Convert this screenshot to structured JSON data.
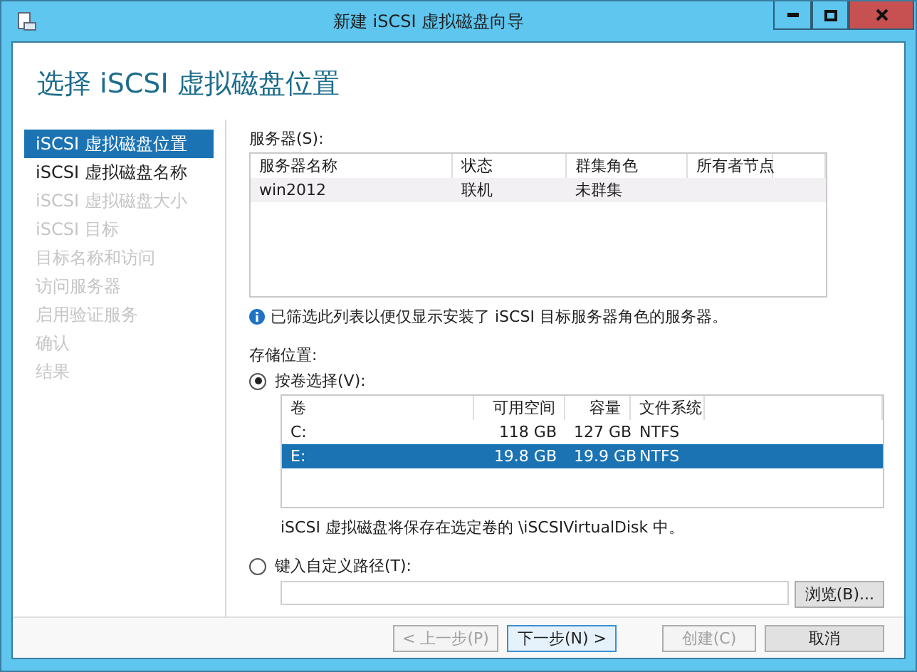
{
  "window": {
    "title": "新建 iSCSI 虚拟磁盘向导"
  },
  "heading": "选择 iSCSI 虚拟磁盘位置",
  "steps": [
    {
      "label": "iSCSI 虚拟磁盘位置",
      "selected": true,
      "disabled": false
    },
    {
      "label": "iSCSI 虚拟磁盘名称",
      "selected": false,
      "disabled": false
    },
    {
      "label": "iSCSI 虚拟磁盘大小",
      "selected": false,
      "disabled": true
    },
    {
      "label": "iSCSI 目标",
      "selected": false,
      "disabled": true
    },
    {
      "label": "目标名称和访问",
      "selected": false,
      "disabled": true
    },
    {
      "label": "访问服务器",
      "selected": false,
      "disabled": true
    },
    {
      "label": "启用验证服务",
      "selected": false,
      "disabled": true
    },
    {
      "label": "确认",
      "selected": false,
      "disabled": true
    },
    {
      "label": "结果",
      "selected": false,
      "disabled": true
    }
  ],
  "servers": {
    "label": "服务器(S):",
    "columns": [
      "服务器名称",
      "状态",
      "群集角色",
      "所有者节点"
    ],
    "rows": [
      {
        "cells": [
          "win2012",
          "联机",
          "未群集",
          ""
        ],
        "selected": false
      }
    ]
  },
  "info_note": "已筛选此列表以便仅显示安装了 iSCSI 目标服务器角色的服务器。",
  "storage_label": "存储位置:",
  "by_volume": {
    "label": "按卷选择(V):",
    "selected": true
  },
  "volumes": {
    "columns": [
      "卷",
      "可用空间",
      "容量",
      "文件系统"
    ],
    "rows": [
      {
        "cells": [
          "C:",
          "118 GB",
          "127 GB",
          "NTFS"
        ],
        "selected": false
      },
      {
        "cells": [
          "E:",
          "19.8 GB",
          "19.9 GB",
          "NTFS"
        ],
        "selected": true
      }
    ]
  },
  "volume_note": "iSCSI 虚拟磁盘将保存在选定卷的 \\iSCSIVirtualDisk 中。",
  "custom_path": {
    "label": "键入自定义路径(T):",
    "selected": false
  },
  "browse_button": "浏览(B)...",
  "buttons": [
    {
      "label": "< 上一步(P)",
      "disabled": true,
      "default": false
    },
    {
      "label": "下一步(N) >",
      "disabled": false,
      "default": true
    },
    {
      "label": "创建(C)",
      "disabled": true,
      "default": false
    },
    {
      "label": "取消",
      "disabled": false,
      "default": false
    }
  ]
}
